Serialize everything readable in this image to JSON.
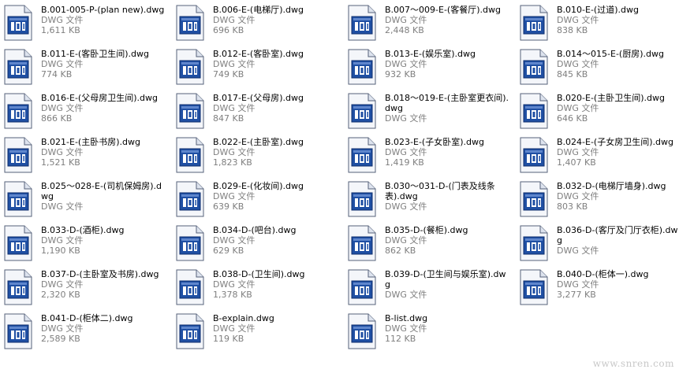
{
  "files": [
    {
      "name": "B.001-005-P-(plan new).dwg",
      "type": "DWG 文件",
      "size": "1,611 KB",
      "icon": "dwg-file-icon"
    },
    {
      "name": "B.006-E-(电梯厅).dwg",
      "type": "DWG 文件",
      "size": "696 KB",
      "icon": "dwg-file-icon"
    },
    {
      "name": "B.007～009-E-(客餐厅).dwg",
      "type": "DWG 文件",
      "size": "2,448 KB",
      "icon": "dwg-file-icon"
    },
    {
      "name": "B.010-E-(过道).dwg",
      "type": "DWG 文件",
      "size": "838 KB",
      "icon": "dwg-file-icon"
    },
    {
      "name": "B.011-E-(客卧卫生间).dwg",
      "type": "DWG 文件",
      "size": "774 KB",
      "icon": "dwg-file-icon"
    },
    {
      "name": "B.012-E-(客卧室).dwg",
      "type": "DWG 文件",
      "size": "749 KB",
      "icon": "dwg-file-icon"
    },
    {
      "name": "B.013-E-(娱乐室).dwg",
      "type": "DWG 文件",
      "size": "932 KB",
      "icon": "dwg-file-icon"
    },
    {
      "name": "B.014～015-E-(厨房).dwg",
      "type": "DWG 文件",
      "size": "845 KB",
      "icon": "dwg-file-icon"
    },
    {
      "name": "B.016-E-(父母房卫生间).dwg",
      "type": "DWG 文件",
      "size": "866 KB",
      "icon": "dwg-file-icon"
    },
    {
      "name": "B.017-E-(父母房).dwg",
      "type": "DWG 文件",
      "size": "847 KB",
      "icon": "dwg-file-icon"
    },
    {
      "name": "B.018～019-E-(主卧室更衣间).dwg",
      "type": "DWG 文件",
      "size": "",
      "icon": "dwg-file-icon"
    },
    {
      "name": "B.020-E-(主卧卫生间).dwg",
      "type": "DWG 文件",
      "size": "646 KB",
      "icon": "dwg-file-icon"
    },
    {
      "name": "B.021-E-(主卧书房).dwg",
      "type": "DWG 文件",
      "size": "1,521 KB",
      "icon": "dwg-file-icon"
    },
    {
      "name": "B.022-E-(主卧室).dwg",
      "type": "DWG 文件",
      "size": "1,823 KB",
      "icon": "dwg-file-icon"
    },
    {
      "name": "B.023-E-(子女卧室).dwg",
      "type": "DWG 文件",
      "size": "1,419 KB",
      "icon": "dwg-file-icon"
    },
    {
      "name": "B.024-E-(子女房卫生间).dwg",
      "type": "DWG 文件",
      "size": "1,407 KB",
      "icon": "dwg-file-icon"
    },
    {
      "name": "B.025～028-E-(司机保姆房).dwg",
      "type": "DWG 文件",
      "size": "",
      "icon": "dwg-file-icon"
    },
    {
      "name": "B.029-E-(化妆间).dwg",
      "type": "DWG 文件",
      "size": "639 KB",
      "icon": "dwg-file-icon"
    },
    {
      "name": "B.030～031-D-(门表及线条表).dwg",
      "type": "DWG 文件",
      "size": "",
      "icon": "dwg-file-icon"
    },
    {
      "name": "B.032-D-(电梯厅墙身).dwg",
      "type": "DWG 文件",
      "size": "803 KB",
      "icon": "dwg-file-icon"
    },
    {
      "name": "B.033-D-(酒柜).dwg",
      "type": "DWG 文件",
      "size": "1,190 KB",
      "icon": "dwg-file-icon"
    },
    {
      "name": "B.034-D-(吧台).dwg",
      "type": "DWG 文件",
      "size": "629 KB",
      "icon": "dwg-file-icon"
    },
    {
      "name": "B.035-D-(餐柜).dwg",
      "type": "DWG 文件",
      "size": "862 KB",
      "icon": "dwg-file-icon"
    },
    {
      "name": "B.036-D-(客厅及门厅衣柜).dwg",
      "type": "DWG 文件",
      "size": "",
      "icon": "dwg-file-icon"
    },
    {
      "name": "B.037-D-(主卧室及书房).dwg",
      "type": "DWG 文件",
      "size": "2,320 KB",
      "icon": "dwg-file-icon"
    },
    {
      "name": "B.038-D-(卫生间).dwg",
      "type": "DWG 文件",
      "size": "1,378 KB",
      "icon": "dwg-file-icon"
    },
    {
      "name": "B.039-D-(卫生间与娱乐室).dwg",
      "type": "DWG 文件",
      "size": "",
      "icon": "dwg-file-icon"
    },
    {
      "name": "B.040-D-(柜体一).dwg",
      "type": "DWG 文件",
      "size": "3,277 KB",
      "icon": "dwg-file-icon"
    },
    {
      "name": "B.041-D-(柜体二).dwg",
      "type": "DWG 文件",
      "size": "2,589 KB",
      "icon": "dwg-file-icon"
    },
    {
      "name": "B-explain.dwg",
      "type": "DWG 文件",
      "size": "119 KB",
      "icon": "dwg-file-icon"
    },
    {
      "name": "B-list.dwg",
      "type": "DWG 文件",
      "size": "112 KB",
      "icon": "dwg-file-icon"
    }
  ],
  "watermark": "www.snren.com",
  "colors": {
    "icon_border": "#5a6b8c",
    "icon_blue": "#1c4fa6",
    "icon_page": "#f0f3f8",
    "secondary_text": "#7f7f7f"
  }
}
